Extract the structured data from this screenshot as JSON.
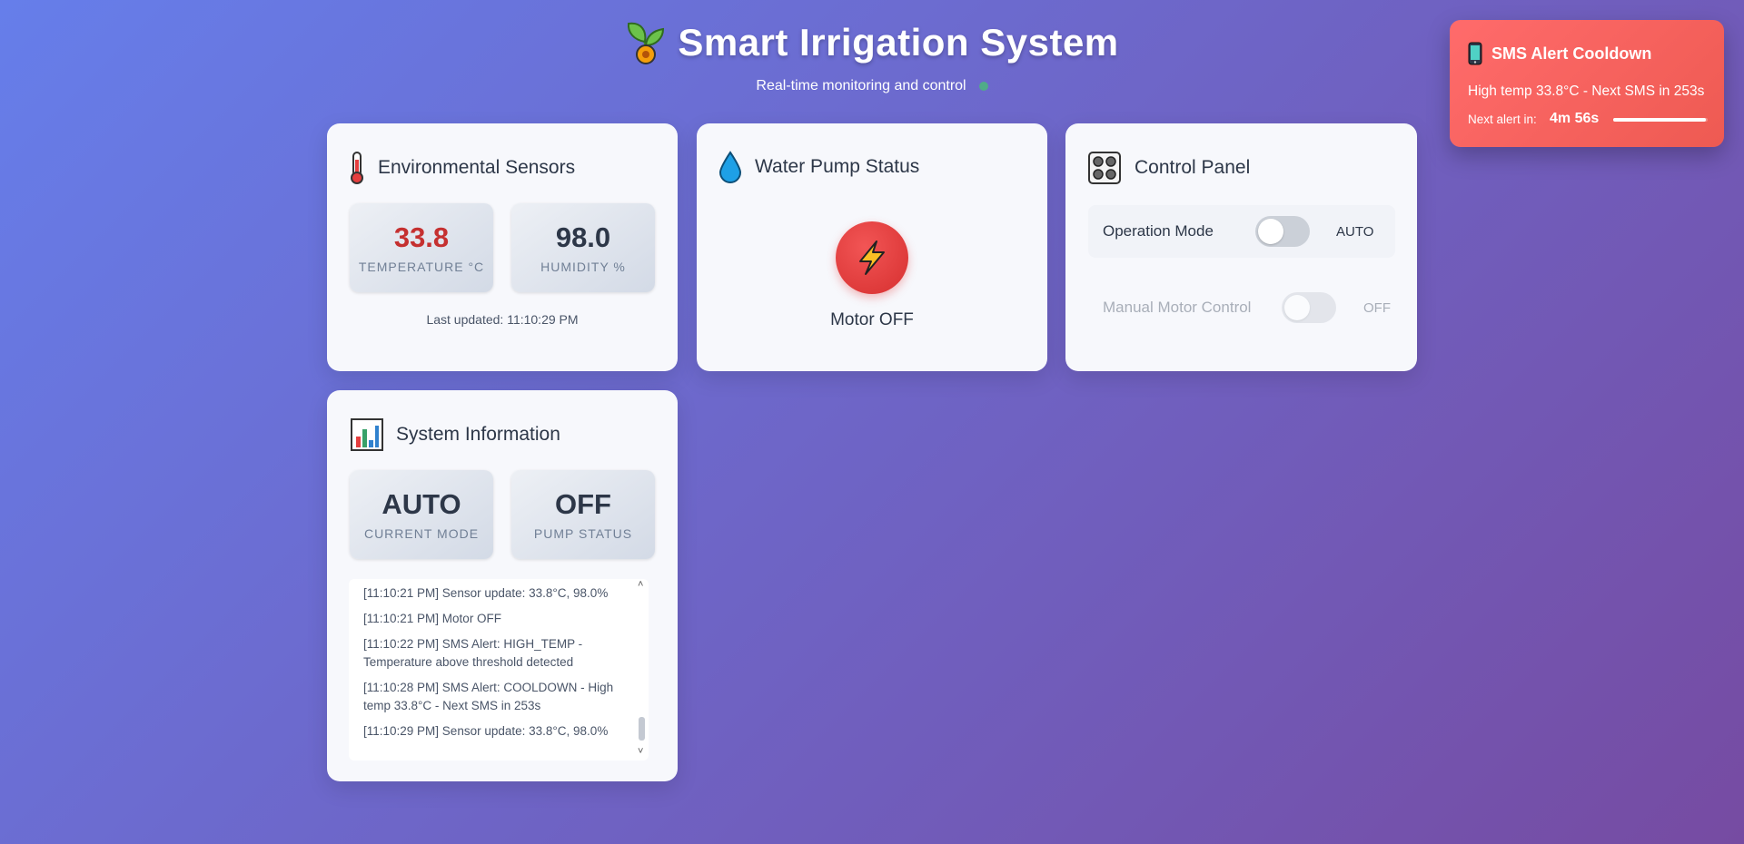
{
  "header": {
    "title": "Smart Irrigation System",
    "subtitle": "Real-time monitoring and control",
    "icon": "seedling-icon"
  },
  "sensors": {
    "title": "Environmental Sensors",
    "icon": "thermometer-icon",
    "temperature": {
      "value": "33.8",
      "label": "Temperature °C",
      "color": "#c53030"
    },
    "humidity": {
      "value": "98.0",
      "label": "Humidity %"
    },
    "last_updated": "Last updated: 11:10:29 PM"
  },
  "pump": {
    "title": "Water Pump Status",
    "icon": "water-drop-icon",
    "status_icon": "lightning-bolt-icon",
    "status_text": "Motor OFF",
    "status_color": "#e53e3e"
  },
  "control": {
    "title": "Control Panel",
    "icon": "control-knobs-icon",
    "operation_mode": {
      "label": "Operation Mode",
      "value": "AUTO",
      "enabled": false
    },
    "manual_motor": {
      "label": "Manual Motor Control",
      "value": "OFF",
      "enabled": false,
      "disabled": true
    }
  },
  "system": {
    "title": "System Information",
    "icon": "bar-chart-icon",
    "current_mode": {
      "value": "AUTO",
      "label": "Current Mode"
    },
    "pump_status": {
      "value": "OFF",
      "label": "Pump Status"
    },
    "log": [
      "[11:10:21 PM] Sensor update: 33.8°C, 98.0%",
      "[11:10:21 PM] Motor OFF",
      "[11:10:22 PM] SMS Alert: HIGH_TEMP - Temperature above threshold detected",
      "[11:10:28 PM] SMS Alert: COOLDOWN - High temp 33.8°C - Next SMS in 253s",
      "[11:10:29 PM] Sensor update: 33.8°C, 98.0%"
    ]
  },
  "sms_alert": {
    "title": "SMS Alert Cooldown",
    "icon": "mobile-phone-icon",
    "message": "High temp 33.8°C - Next SMS in 253s",
    "next_label": "Next alert in:",
    "next_value": "4m 56s",
    "progress": 0.98,
    "colors": [
      "#ff6b6b",
      "#ee5a52"
    ]
  }
}
